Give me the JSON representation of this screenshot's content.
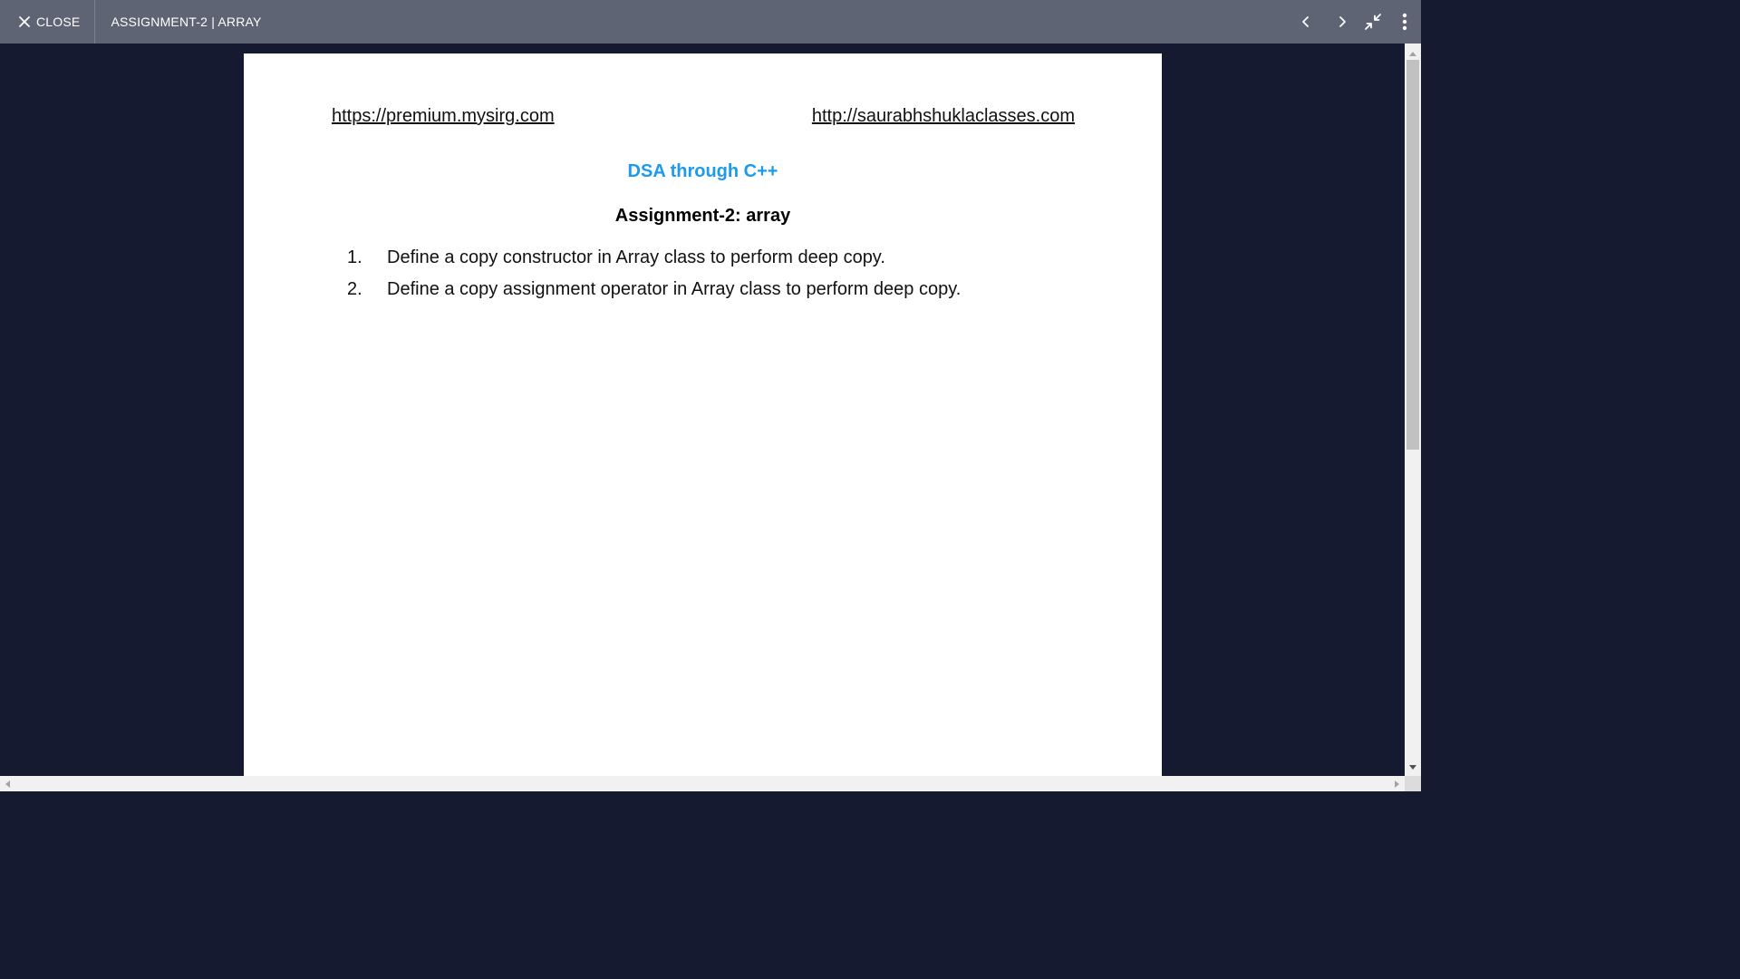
{
  "toolbar": {
    "close_label": "CLOSE",
    "document_title": "ASSIGNMENT-2 | ARRAY",
    "icons": [
      "close-icon",
      "chevron-left-icon",
      "chevron-right-icon",
      "exit-fullscreen-icon",
      "more-vert-icon"
    ]
  },
  "document": {
    "link_left": "https://premium.mysirg.com",
    "link_right": "http://saurabhshuklaclasses.com",
    "course_title": "DSA through C++",
    "assignment_title": "Assignment-2: array",
    "tasks": [
      {
        "number": "1.",
        "text": "Define a copy constructor in Array class to perform deep copy."
      },
      {
        "number": "2.",
        "text": "Define a copy assignment operator in Array class to perform deep copy."
      }
    ]
  },
  "colors": {
    "toolbar_bg": "#5f6475",
    "viewer_bg": "#151a30",
    "course_title": "#1b9af0"
  }
}
